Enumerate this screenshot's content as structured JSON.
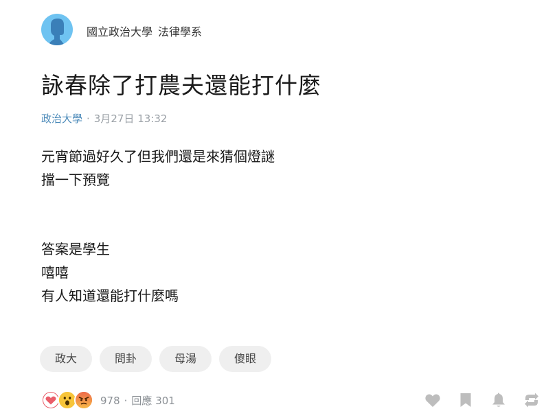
{
  "author": {
    "school": "國立政治大學",
    "department": "法律學系"
  },
  "post": {
    "title": "詠春除了打農夫還能打什麼",
    "forum": "政治大學",
    "time": "3月27日 13:32",
    "content": {
      "paragraph1": [
        "元宵節過好久了但我們還是來猜個燈謎",
        "擋一下預覽"
      ],
      "paragraph2": [
        "答案是學生",
        "嘻嘻",
        "有人知道還能打什麼嗎"
      ]
    },
    "tags": [
      "政大",
      "問卦",
      "母湯",
      "傻眼"
    ]
  },
  "footer": {
    "reaction_icons": [
      "heart-icon",
      "wow-icon",
      "angry-icon"
    ],
    "like_count": "978",
    "comment_label": "回應 301",
    "actions": [
      "heart-icon",
      "bookmark-icon",
      "bell-icon",
      "share-icon"
    ]
  },
  "colors": {
    "forum_link": "#4b8ab9",
    "avatar": "#6fc3f1",
    "icon_gray": "#bdbdbd",
    "tag_bg": "#efefef"
  }
}
